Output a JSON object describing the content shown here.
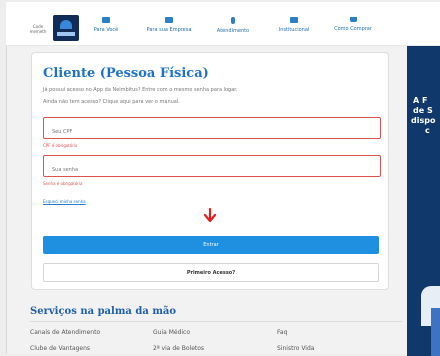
{
  "header": {
    "brand_small": "Code\nmemeth",
    "nav": [
      {
        "label": "Para Você",
        "icon": "people-icon"
      },
      {
        "label": "Para sua Empresa",
        "icon": "building-icon"
      },
      {
        "label": "Atendimento",
        "icon": "phone-icon"
      },
      {
        "label": "Institucional",
        "icon": "institution-icon"
      },
      {
        "label": "Como Comprar",
        "icon": "cart-icon"
      }
    ]
  },
  "login": {
    "title": "Cliente (Pessoa Física)",
    "desc1": "Já possui acesso no App da Neimbitus? Entre com o mesmo senha para logar.",
    "desc2": "Ainda não tem acesso? Clique aqui para ver o manual.",
    "cpf_placeholder": "Seu CPF",
    "cpf_error": "CPF é obrigatório",
    "password_placeholder": "Sua senha",
    "password_error": "Senha é obrigatória",
    "forgot_link": "Esqueci minha senha",
    "submit_label": "Entrar",
    "first_access_label": "Primeiro Acesso?"
  },
  "banner": {
    "lines": [
      "A F",
      "de S",
      "dispo",
      "c"
    ]
  },
  "services": {
    "title": "Serviços na palma da mão",
    "items": [
      "Canais de Atendimento",
      "Guia Médico",
      "Faq",
      "Clube de Vantagens",
      "2ª via de Boletos",
      "Sinistro Vida"
    ]
  },
  "colors": {
    "brand_blue": "#1e73c9",
    "navy": "#11386b",
    "error_red": "#d9534f",
    "button_blue": "#1f8fe0",
    "arrow_red": "#e02020"
  }
}
